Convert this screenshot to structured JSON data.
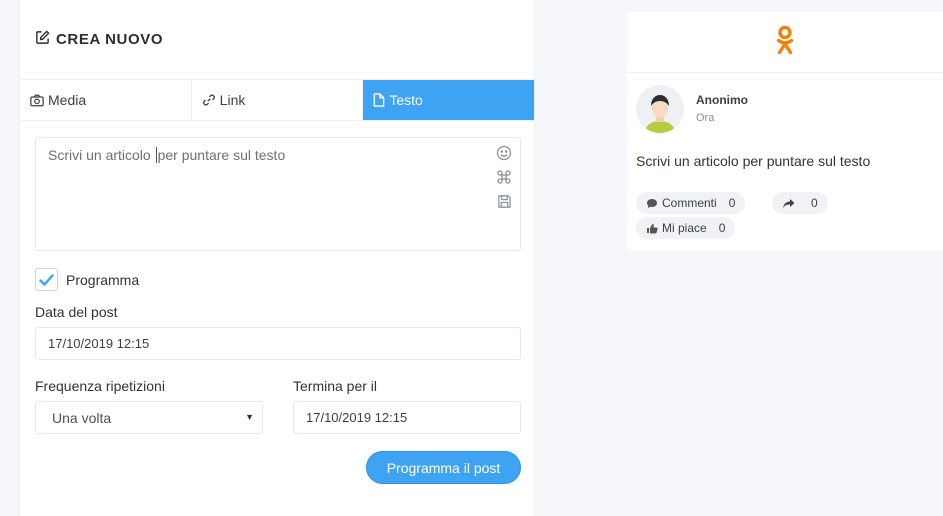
{
  "composer": {
    "title": "CREA NUOVO",
    "tabs": [
      {
        "label": "Media",
        "icon": "camera-icon"
      },
      {
        "label": "Link",
        "icon": "link-icon"
      },
      {
        "label": "Testo",
        "icon": "file-icon",
        "active": true
      }
    ],
    "editor": {
      "text_before_caret": "Scrivi un articolo ",
      "text_after_caret": "per puntare sul testo",
      "tools": [
        "emoji-icon",
        "command-icon",
        "save-icon"
      ]
    },
    "schedule": {
      "checkbox_label": "Programma",
      "checked": true,
      "post_date_label": "Data del post",
      "post_date_value": "17/10/2019 12:15",
      "frequency_label": "Frequenza ripetizioni",
      "frequency_value": "Una volta",
      "end_label": "Termina per il",
      "end_value": "17/10/2019 12:15"
    },
    "submit_label": "Programma il post"
  },
  "preview": {
    "network_icon": "odnoklassniki-icon",
    "author": "Anonimo",
    "time": "Ora",
    "text": "Scrivi un articolo per puntare sul testo",
    "actions": {
      "comments_label": "Commenti",
      "comments_count": "0",
      "shares_count": "0",
      "likes_label": "Mi piace",
      "likes_count": "0"
    }
  },
  "colors": {
    "accent": "#3ea3f2",
    "brand_ok": "#ee8208"
  }
}
